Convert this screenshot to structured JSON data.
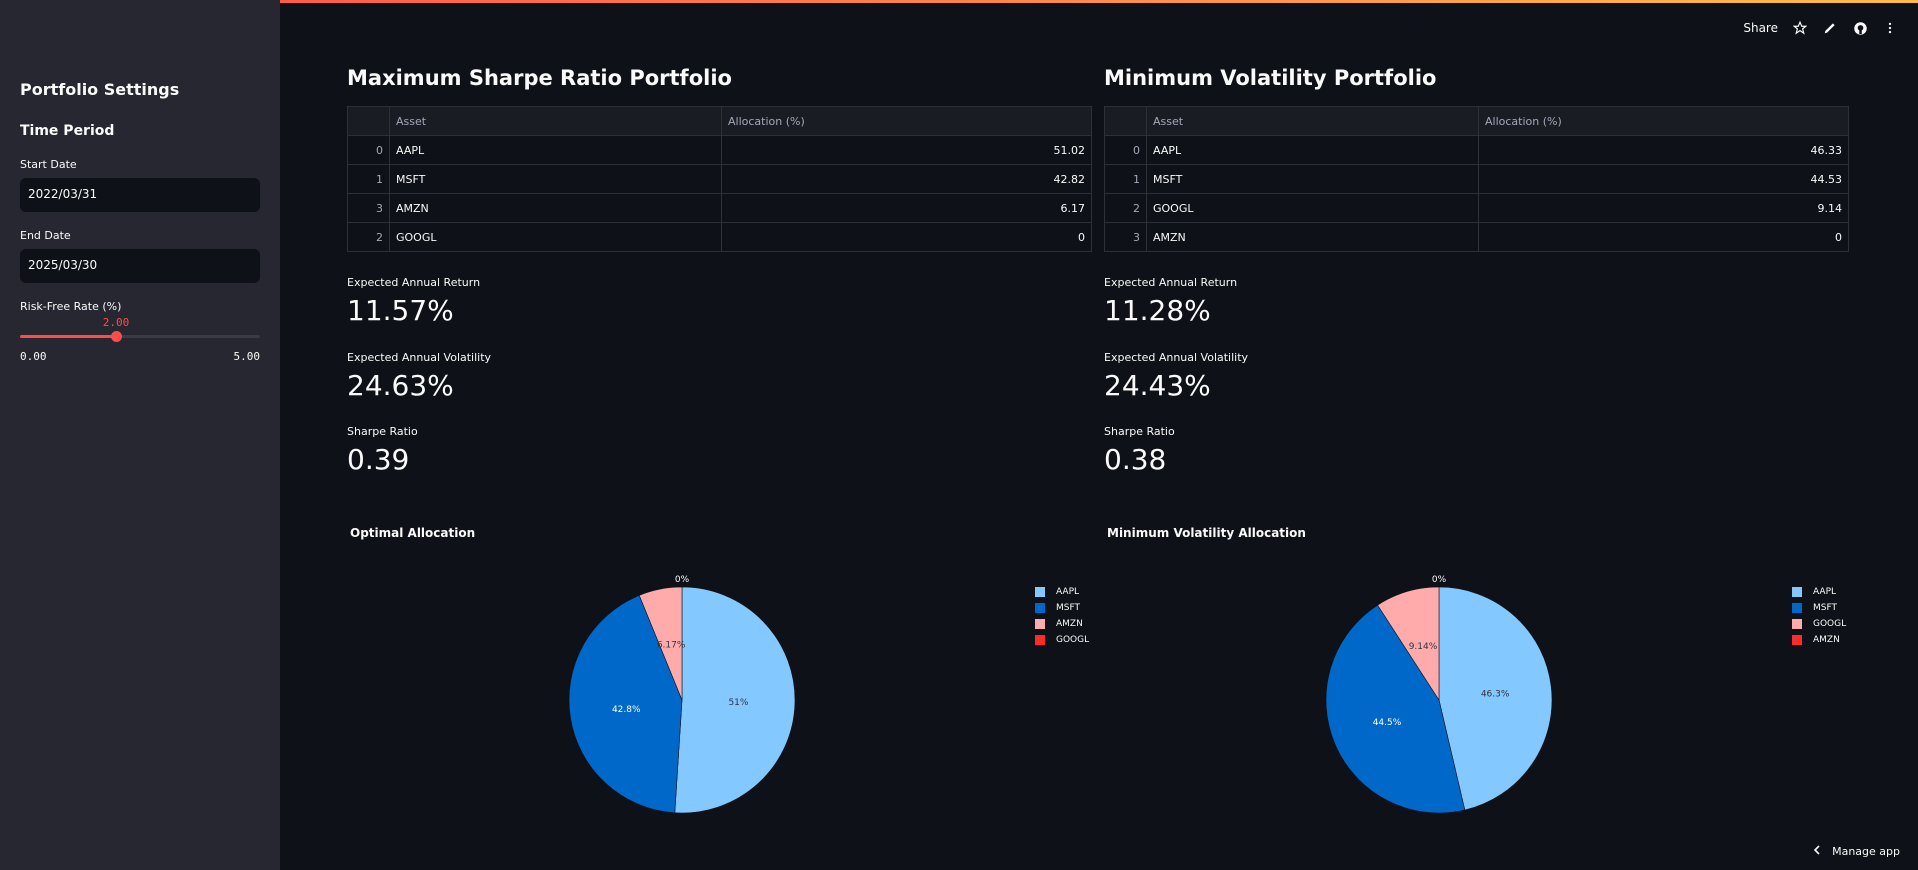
{
  "sidebar": {
    "title": "Portfolio Settings",
    "section": "Time Period",
    "start_label": "Start Date",
    "start_value": "2022/03/31",
    "end_label": "End Date",
    "end_value": "2025/03/30",
    "rate_label": "Risk-Free Rate (%)",
    "rate_value": "2.00",
    "rate_number": 2.0,
    "rate_min": "0.00",
    "rate_max": "5.00",
    "rate_min_number": 0,
    "rate_max_number": 5
  },
  "toolbar": {
    "share": "Share"
  },
  "footer": {
    "manage": "Manage app"
  },
  "columns": [
    {
      "title": "Maximum Sharpe Ratio Portfolio",
      "table": {
        "headers": [
          "",
          "Asset",
          "Allocation (%)"
        ],
        "rows": [
          {
            "idx": "0",
            "asset": "AAPL",
            "alloc": "51.02"
          },
          {
            "idx": "1",
            "asset": "MSFT",
            "alloc": "42.82"
          },
          {
            "idx": "3",
            "asset": "AMZN",
            "alloc": "6.17"
          },
          {
            "idx": "2",
            "asset": "GOOGL",
            "alloc": "0"
          }
        ]
      },
      "metrics": [
        {
          "label": "Expected Annual Return",
          "value": "11.57%"
        },
        {
          "label": "Expected Annual Volatility",
          "value": "24.63%"
        },
        {
          "label": "Sharpe Ratio",
          "value": "0.39"
        }
      ],
      "chart_title": "Optimal Allocation"
    },
    {
      "title": "Minimum Volatility Portfolio",
      "table": {
        "headers": [
          "",
          "Asset",
          "Allocation (%)"
        ],
        "rows": [
          {
            "idx": "0",
            "asset": "AAPL",
            "alloc": "46.33"
          },
          {
            "idx": "1",
            "asset": "MSFT",
            "alloc": "44.53"
          },
          {
            "idx": "2",
            "asset": "GOOGL",
            "alloc": "9.14"
          },
          {
            "idx": "3",
            "asset": "AMZN",
            "alloc": "0"
          }
        ]
      },
      "metrics": [
        {
          "label": "Expected Annual Return",
          "value": "11.28%"
        },
        {
          "label": "Expected Annual Volatility",
          "value": "24.43%"
        },
        {
          "label": "Sharpe Ratio",
          "value": "0.38"
        }
      ],
      "chart_title": "Minimum Volatility Allocation"
    }
  ],
  "chart_data": [
    {
      "type": "pie",
      "title": "Optimal Allocation",
      "categories": [
        "AAPL",
        "MSFT",
        "AMZN",
        "GOOGL"
      ],
      "values": [
        51.02,
        42.82,
        6.17,
        0
      ],
      "slice_labels": [
        "51%",
        "42.8%",
        "6.17%",
        "0%"
      ],
      "colors": [
        "#83c9ff",
        "#0068c9",
        "#ffabab",
        "#ff2b2b"
      ],
      "legend": "top-right"
    },
    {
      "type": "pie",
      "title": "Minimum Volatility Allocation",
      "categories": [
        "AAPL",
        "MSFT",
        "GOOGL",
        "AMZN"
      ],
      "values": [
        46.33,
        44.53,
        9.14,
        0
      ],
      "slice_labels": [
        "46.3%",
        "44.5%",
        "9.14%",
        "0%"
      ],
      "colors": [
        "#83c9ff",
        "#0068c9",
        "#ffabab",
        "#ff2b2b"
      ],
      "legend": "top-right"
    }
  ]
}
